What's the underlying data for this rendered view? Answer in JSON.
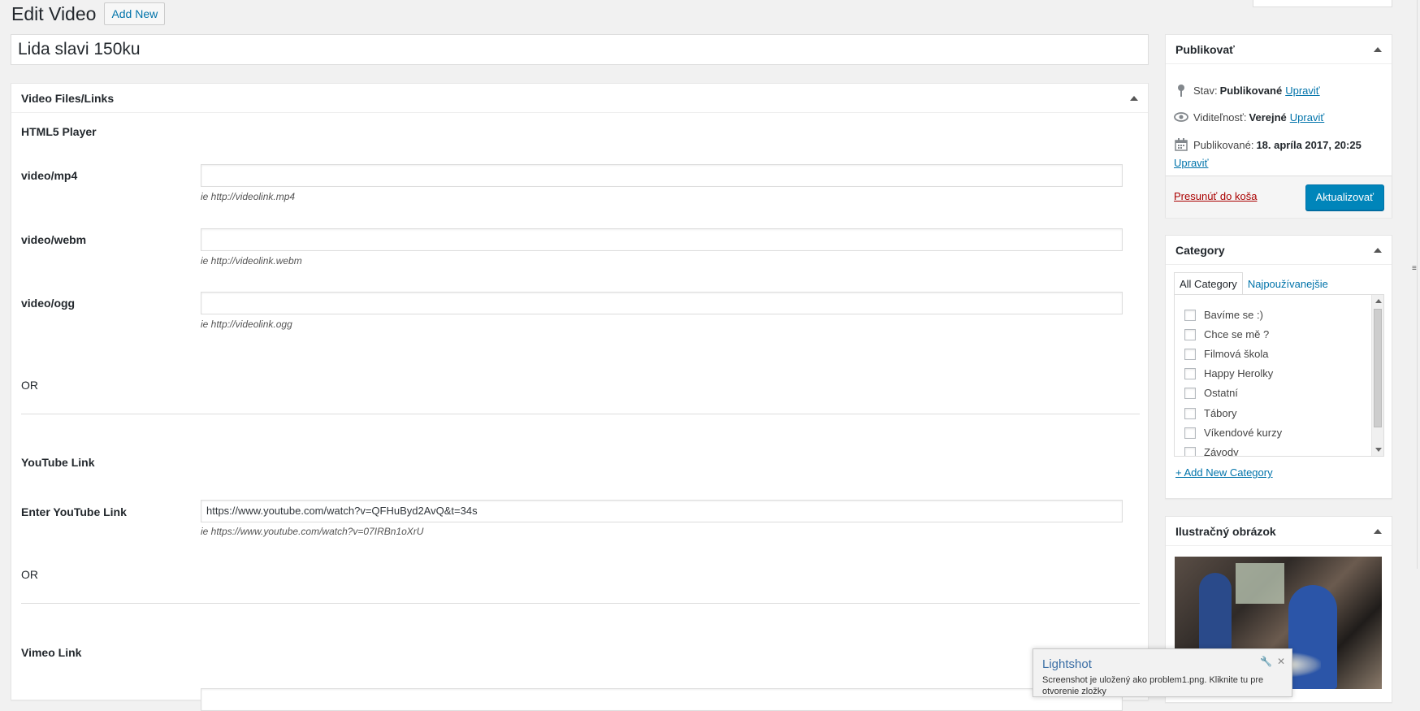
{
  "header": {
    "title": "Edit Video",
    "add_new_label": "Add New"
  },
  "post": {
    "title_value": "Lida slavi 150ku"
  },
  "video_box": {
    "title": "Video Files/Links",
    "html5_section": "HTML5 Player",
    "fields": [
      {
        "label": "video/mp4",
        "value": "",
        "hint": "ie http://videolink.mp4"
      },
      {
        "label": "video/webm",
        "value": "",
        "hint": "ie http://videolink.webm"
      },
      {
        "label": "video/ogg",
        "value": "",
        "hint": "ie http://videolink.ogg"
      }
    ],
    "or1": "OR",
    "youtube_section": "YouTube Link",
    "youtube_label": "Enter YouTube Link",
    "youtube_value": "https://www.youtube.com/watch?v=QFHuByd2AvQ&t=34s",
    "youtube_hint": "ie https://www.youtube.com/watch?v=07IRBn1oXrU",
    "or2": "OR",
    "vimeo_section": "Vimeo Link"
  },
  "publish": {
    "title": "Publikovať",
    "status_label": "Stav:",
    "status_value": "Publikované",
    "status_edit": "Upraviť",
    "visibility_label": "Viditeľnosť:",
    "visibility_value": "Verejné",
    "visibility_edit": "Upraviť",
    "published_label": "Publikované:",
    "published_value": "18. apríla 2017, 20:25",
    "published_edit": "Upraviť",
    "trash_label": "Presunúť do koša",
    "update_label": "Aktualizovať"
  },
  "category": {
    "title": "Category",
    "tab_all": "All Category",
    "tab_popular": "Najpoužívanejšie",
    "items": [
      "Bavíme se :)",
      "Chce se mě ?",
      "Filmová škola",
      "Happy Herolky",
      "Ostatní",
      "Tábory",
      "Víkendové kurzy",
      "Závody"
    ],
    "add_new": "+ Add New Category"
  },
  "featured_image": {
    "title": "Ilustračný obrázok"
  },
  "toast": {
    "title": "Lightshot",
    "text": "Screenshot je uložený ako problem1.png. Kliknite tu pre otvorenie zložky"
  },
  "colors": {
    "primary": "#0085ba",
    "link": "#0073aa",
    "danger": "#a00",
    "background": "#f1f1f1"
  }
}
